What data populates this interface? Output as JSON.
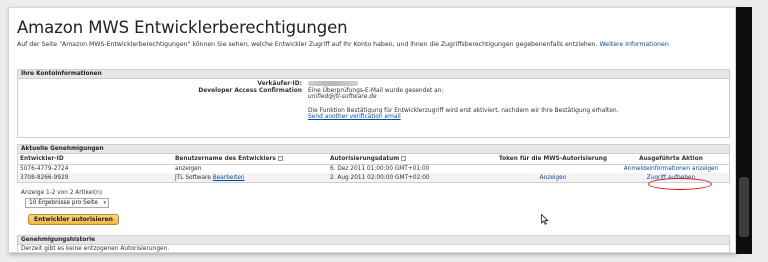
{
  "page": {
    "title": "Amazon MWS Entwicklerberechtigungen",
    "intro_text": "Auf der Seite \"Amazon MWS-Entwicklerberechtigungen\" können Sie sehen, welche Entwickler Zugriff auf Ihr Konto haben, und ihnen die Zugriffsberechtigungen gegebenenfalls entziehen.",
    "intro_link": "Weitere Informationen"
  },
  "account": {
    "header": "Ihre Kontoinformationen",
    "seller_id_label": "Verkäufer-ID:",
    "dev_access_label": "Developer Access Confirmation",
    "email_sent_text": "Eine Überprüfungs-E-Mail wurde gesendet an:",
    "email": "unified@jtl-software.de",
    "activation_text": "Die Funktion Bestätigung für Entwicklerzugriff wird erst aktiviert, nachdem wir Ihre Bestätigung erhalten.",
    "resend_link": "Send another verification email"
  },
  "permissions": {
    "header": "Aktuelle Genehmigungen",
    "columns": [
      "Entwickler-ID",
      "Benutzername des Entwicklers",
      "Autorisierungsdatum",
      "Token für die MWS-Autorisierung",
      "Ausgeführte Aktion"
    ],
    "rows": [
      {
        "id": "5076-4779-2724",
        "username": "anzeigen",
        "edit": "",
        "date": "6. Dez 2011 01:00:00 GMT+01:00",
        "token": "",
        "action": "Anmeldeinformationen anzeigen"
      },
      {
        "id": "3708-8266-9929",
        "username": "JTL Software",
        "edit": "Bearbeiten",
        "date": "2. Aug 2011 02:00:00 GMT+02:00",
        "token": "Anzeigen",
        "action": "Zugriff aufheben"
      }
    ]
  },
  "paging": {
    "summary": "Anzeige 1-2 von 2 Artikel(n)",
    "per_page": "10 Ergebnisse pro Seite"
  },
  "authorize_button": "Entwickler autorisieren",
  "history": {
    "header": "Genehmigungshistorie",
    "empty_text": "Derzeit gibt es keine entzogenen Autorisierungen."
  },
  "colors": {
    "link": "#0a4a9e",
    "highlight_circle": "#d81a1a",
    "button": "#f0b73a",
    "scrollbar": "#0e0e0e"
  }
}
